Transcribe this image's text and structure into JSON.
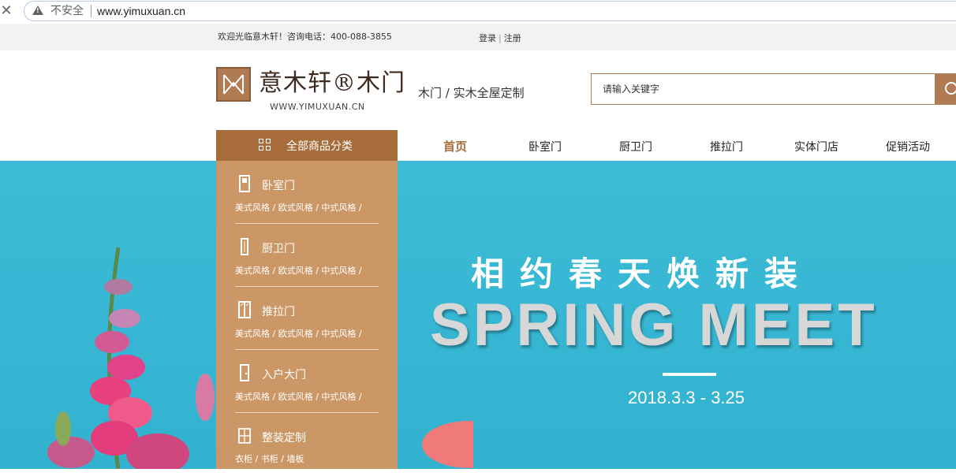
{
  "browser": {
    "close_icon": "close-icon",
    "security_label": "不安全",
    "url": "www.yimuxuan.cn"
  },
  "topbar": {
    "welcome": "欢迎光临意木轩！咨询电话：400-088-3855",
    "login": "登录",
    "register": "注册"
  },
  "header": {
    "logo_name": "意木轩®木门",
    "logo_url": "WWW.YIMUXUAN.CN",
    "slogan": "木门 / 实木全屋定制",
    "search_placeholder": "请输入关键字"
  },
  "nav": {
    "category_label": "全部商品分类",
    "items": [
      "首页",
      "卧室门",
      "厨卫门",
      "推拉门",
      "实体门店",
      "促销活动"
    ]
  },
  "categories": [
    {
      "title": "卧室门",
      "sub": "美式风格 / 欧式风格 / 中式风格 /",
      "icon": "door-icon"
    },
    {
      "title": "厨卫门",
      "sub": "美式风格 / 欧式风格 / 中式风格 /",
      "icon": "narrow-door-icon"
    },
    {
      "title": "推拉门",
      "sub": "美式风格 / 欧式风格 / 中式风格 /",
      "icon": "sliding-door-icon"
    },
    {
      "title": "入户大门",
      "sub": "美式风格 / 欧式风格 / 中式风格 /",
      "icon": "entry-door-icon"
    },
    {
      "title": "整装定制",
      "sub": "衣柜 / 书柜 / 墙板",
      "icon": "cabinet-icon"
    }
  ],
  "banner": {
    "title": "相约春天焕新装",
    "subtitle": "SPRING MEET",
    "date": "2018.3.3 - 3.25"
  },
  "colors": {
    "brand": "#a66d3b",
    "panel": "#cc9766",
    "banner": "#3dbbd6"
  }
}
